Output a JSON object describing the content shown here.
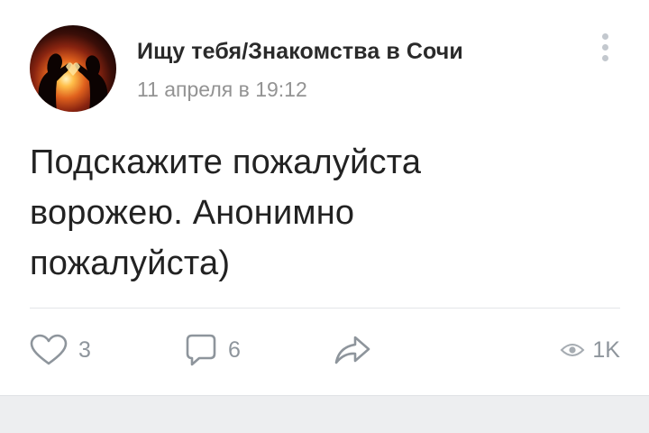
{
  "post": {
    "group_name": "Ищу тебя/Знакомства в Сочи",
    "date": "11 апреля в 19:12",
    "text_lines": [
      "Подскажите пожалуйста",
      "ворожею. Анонимно",
      "пожалуйста)"
    ]
  },
  "actions": {
    "likes": "3",
    "comments": "6",
    "views": "1K"
  },
  "icons": {
    "like": "heart-icon",
    "comment": "comment-bubble-icon",
    "share": "share-arrow-icon",
    "views": "eye-icon",
    "more": "more-vertical-icon"
  },
  "colors": {
    "text": "#222222",
    "muted": "#939393",
    "icon": "#8e959c",
    "background_bar": "#edeef0"
  }
}
